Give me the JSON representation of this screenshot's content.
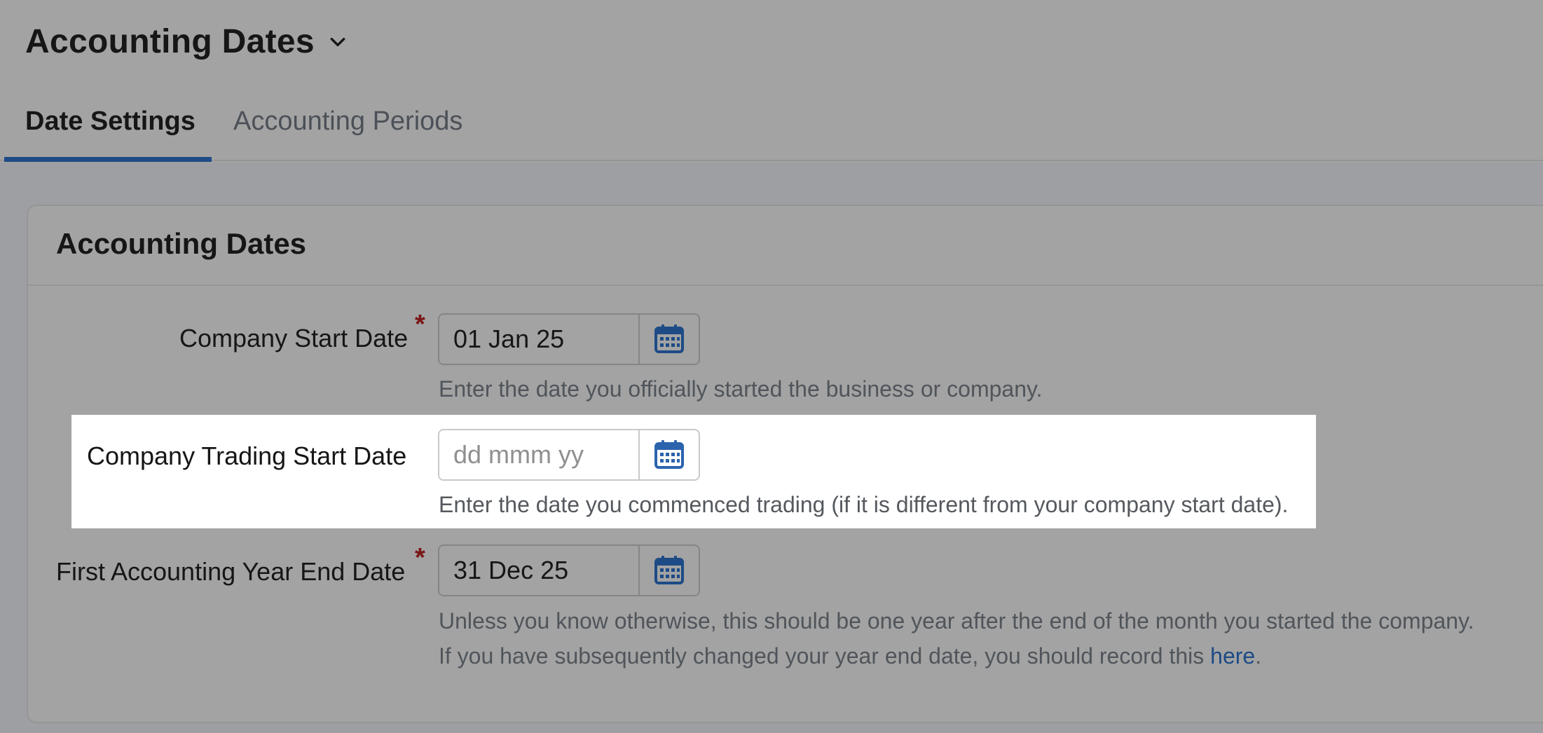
{
  "header": {
    "title": "Accounting Dates"
  },
  "tabs": [
    {
      "label": "Date Settings",
      "active": true
    },
    {
      "label": "Accounting Periods",
      "active": false
    }
  ],
  "card": {
    "title": "Accounting Dates"
  },
  "fields": {
    "company_start": {
      "label": "Company Start Date",
      "required": "*",
      "value": "01 Jan 25",
      "help": "Enter the date you officially started the business or company."
    },
    "trading_start": {
      "label": "Company Trading Start Date",
      "placeholder": "dd mmm yy",
      "help": "Enter the date you commenced trading (if it is different from your company start date)."
    },
    "year_end": {
      "label": "First Accounting Year End Date",
      "required": "*",
      "value": "31 Dec 25",
      "help_line1": "Unless you know otherwise, this should be one year after the end of the month you started the company.",
      "help_line2_prefix": "If you have subsequently changed your year end date, you should record this ",
      "help_line2_link": "here",
      "help_line2_suffix": "."
    }
  },
  "icons": {
    "calendar": "calendar-icon",
    "chevron": "chevron-down-icon"
  },
  "colors": {
    "accent": "#1d4b86",
    "required": "#7b1616",
    "link": "#1d4b86"
  }
}
